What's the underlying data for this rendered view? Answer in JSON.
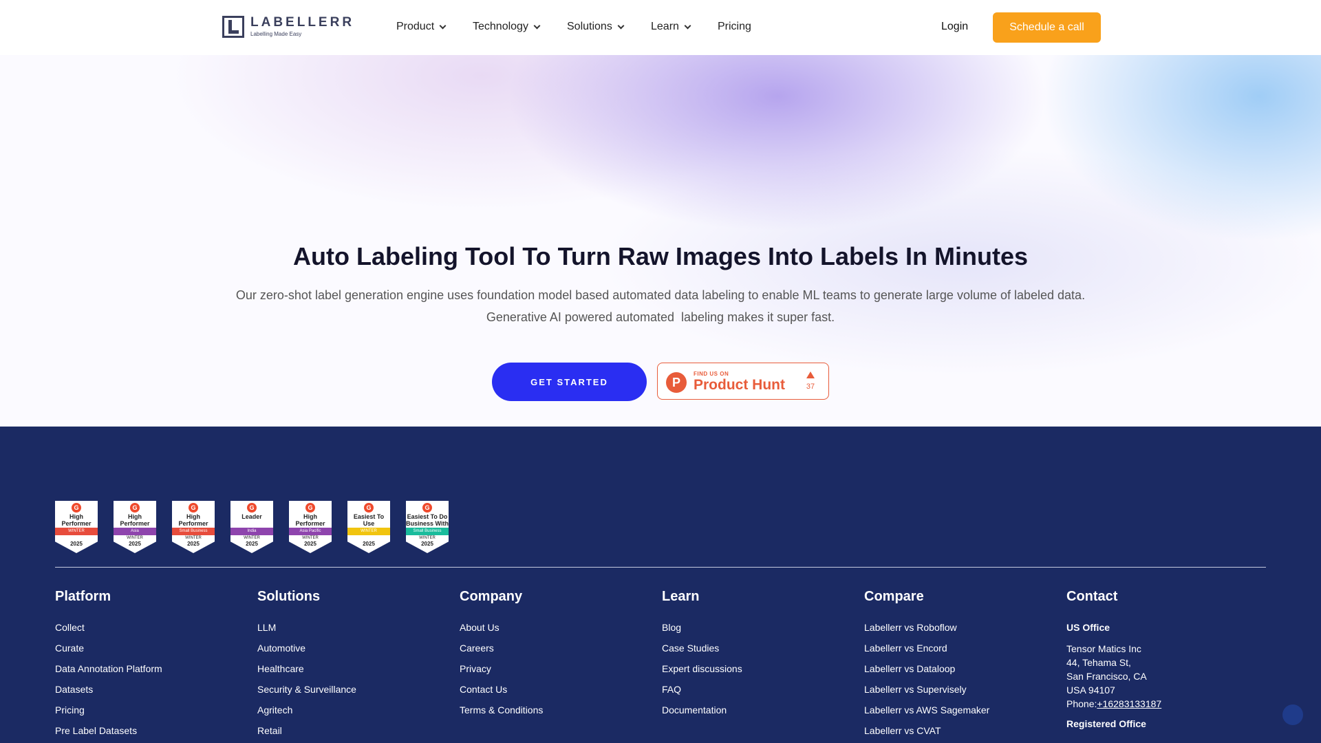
{
  "brand": {
    "name": "LABELLERR",
    "tagline": "Labelling Made Easy"
  },
  "nav": {
    "items": [
      {
        "label": "Product",
        "dropdown": true
      },
      {
        "label": "Technology",
        "dropdown": true
      },
      {
        "label": "Solutions",
        "dropdown": true
      },
      {
        "label": "Learn",
        "dropdown": true
      },
      {
        "label": "Pricing",
        "dropdown": false
      }
    ],
    "login": "Login",
    "cta": "Schedule a call"
  },
  "hero": {
    "title": "Auto Labeling Tool To Turn Raw Images Into Labels In Minutes",
    "subtitle_line1": "Our zero-shot label generation engine uses foundation model based automated data labeling to enable ML teams to generate large volume of labeled data.",
    "subtitle_line2": "Generative AI powered automated  labeling makes it super fast.",
    "get_started": "GET STARTED",
    "product_hunt": {
      "small": "FIND US ON",
      "big": "Product Hunt",
      "count": "37",
      "letter": "P"
    }
  },
  "badges": [
    {
      "title": "High Performer",
      "region": "WINTER",
      "season": "",
      "year": "2025",
      "ribbon": "#e74c3c"
    },
    {
      "title": "High Performer",
      "region": "Asia",
      "season": "WINTER",
      "year": "2025",
      "ribbon": "#8e44ad"
    },
    {
      "title": "High Performer",
      "region": "Small Business",
      "season": "WINTER",
      "year": "2025",
      "ribbon": "#e74c3c"
    },
    {
      "title": "Leader",
      "region": "India",
      "season": "WINTER",
      "year": "2025",
      "ribbon": "#8e44ad"
    },
    {
      "title": "High Performer",
      "region": "Asia Pacific",
      "season": "WINTER",
      "year": "2025",
      "ribbon": "#8e44ad"
    },
    {
      "title": "Easiest To Use",
      "region": "WINTER",
      "season": "",
      "year": "2025",
      "ribbon": "#f1c40f"
    },
    {
      "title": "Easiest To Do Business With",
      "region": "Small Business",
      "season": "WINTER",
      "year": "2025",
      "ribbon": "#1abc9c"
    }
  ],
  "footer": {
    "platform": {
      "title": "Platform",
      "links": [
        "Collect",
        "Curate",
        "Data Annotation Platform",
        "Datasets",
        "Pricing",
        "Pre Label Datasets"
      ]
    },
    "solutions": {
      "title": "Solutions",
      "links": [
        "LLM",
        "Automotive",
        "Healthcare",
        "Security & Surveillance",
        "Agritech",
        "Retail"
      ]
    },
    "company": {
      "title": "Company",
      "links": [
        "About Us",
        "Careers",
        "Privacy",
        "Contact Us",
        "Terms & Conditions"
      ]
    },
    "learn": {
      "title": "Learn",
      "links": [
        "Blog",
        "Case Studies",
        "Expert discussions",
        "FAQ",
        "Documentation"
      ]
    },
    "compare": {
      "title": "Compare",
      "links": [
        "Labellerr vs Roboflow",
        "Labellerr vs Encord",
        "Labellerr vs Dataloop",
        "Labellerr vs Supervisely",
        "Labellerr vs AWS Sagemaker",
        "Labellerr vs CVAT"
      ]
    },
    "contact": {
      "title": "Contact",
      "us_office": "US Office",
      "company": "Tensor Matics Inc",
      "street": "44, Tehama St,",
      "city": "San Francisco, CA",
      "zip": "USA 94107",
      "phone_label": "Phone:",
      "phone": "+16283133187",
      "registered": "Registered Office"
    }
  }
}
